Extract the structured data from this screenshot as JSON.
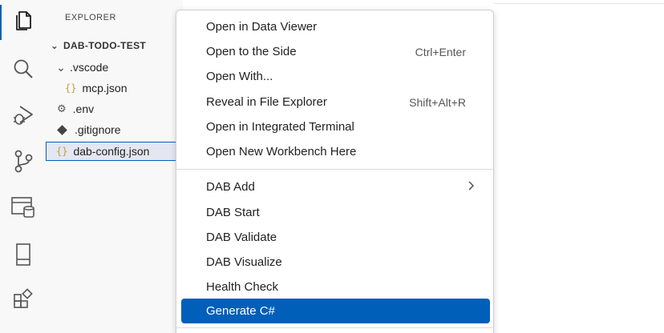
{
  "activity_bar": {
    "items": [
      {
        "name": "explorer",
        "icon": "files-icon",
        "active": true
      },
      {
        "name": "search",
        "icon": "search-icon"
      },
      {
        "name": "run-debug",
        "icon": "run-debug-icon"
      },
      {
        "name": "source-control",
        "icon": "source-control-icon"
      },
      {
        "name": "database",
        "icon": "database-icon"
      },
      {
        "name": "panel",
        "icon": "panel-icon"
      },
      {
        "name": "extensions",
        "icon": "extensions-icon"
      }
    ],
    "accent_color": "#005fb8"
  },
  "sidebar": {
    "title": "EXPLORER",
    "root_folder": "DAB-TODO-TEST",
    "items": [
      {
        "label": ".vscode",
        "type": "folder",
        "expanded": true
      },
      {
        "label": "mcp.json",
        "type": "json"
      },
      {
        "label": ".env",
        "type": "settings"
      },
      {
        "label": ".gitignore",
        "type": "git"
      },
      {
        "label": "dab-config.json",
        "type": "json",
        "selected": true
      }
    ]
  },
  "context_menu": {
    "groups": [
      [
        {
          "label": "Open in Data Viewer",
          "shortcut": ""
        },
        {
          "label": "Open to the Side",
          "shortcut": "Ctrl+Enter"
        },
        {
          "label": "Open With...",
          "shortcut": ""
        },
        {
          "label": "Reveal in File Explorer",
          "shortcut": "Shift+Alt+R"
        },
        {
          "label": "Open in Integrated Terminal",
          "shortcut": ""
        },
        {
          "label": "Open New Workbench Here",
          "shortcut": ""
        }
      ],
      [
        {
          "label": "DAB Add",
          "submenu": true
        },
        {
          "label": "DAB Start"
        },
        {
          "label": "DAB Validate"
        },
        {
          "label": "DAB Visualize"
        },
        {
          "label": "Health Check"
        },
        {
          "label": "Generate C#",
          "highlighted": true
        }
      ]
    ],
    "highlight_color": "#005fb8"
  }
}
